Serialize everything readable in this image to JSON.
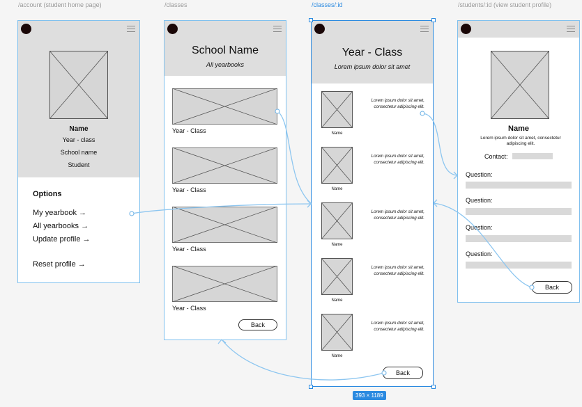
{
  "frames": {
    "account": {
      "label": "/account (student home page)",
      "name": "Name",
      "year_class": "Year - class",
      "school": "School name",
      "role": "Student",
      "options_title": "Options",
      "links": [
        "My yearbook →",
        "All yearbooks →",
        "Update profile →",
        "Reset profile →"
      ]
    },
    "classes": {
      "label": "/classes",
      "title": "School Name",
      "subtitle": "All yearbooks",
      "card_label": "Year - Class",
      "cards_count": 4,
      "back": "Back"
    },
    "class_id": {
      "label": "/classes/:id",
      "title": "Year - Class",
      "subtitle": "Lorem ipsum dolor sit amet",
      "student_name": "Name",
      "student_text": "Lorem ipsum dolor sit amet, consectetur adipiscing elit.",
      "back": "Back",
      "size_badge": "393 × 1189"
    },
    "student": {
      "label": "/students/:id (view student profile)",
      "name": "Name",
      "bio": "Lorem ipsum dolor sit amet, consectetur adipiscing elit.",
      "contact": "Contact:",
      "question": "Question:",
      "back": "Back"
    }
  },
  "colors": {
    "frame_border": "#7fc0ee",
    "selected": "#2b8ae0",
    "header_grey": "#dedede",
    "connector": "#8dc6f0"
  },
  "icons": [
    "avatar-dot-icon",
    "hamburger-menu-icon",
    "image-placeholder-icon"
  ]
}
